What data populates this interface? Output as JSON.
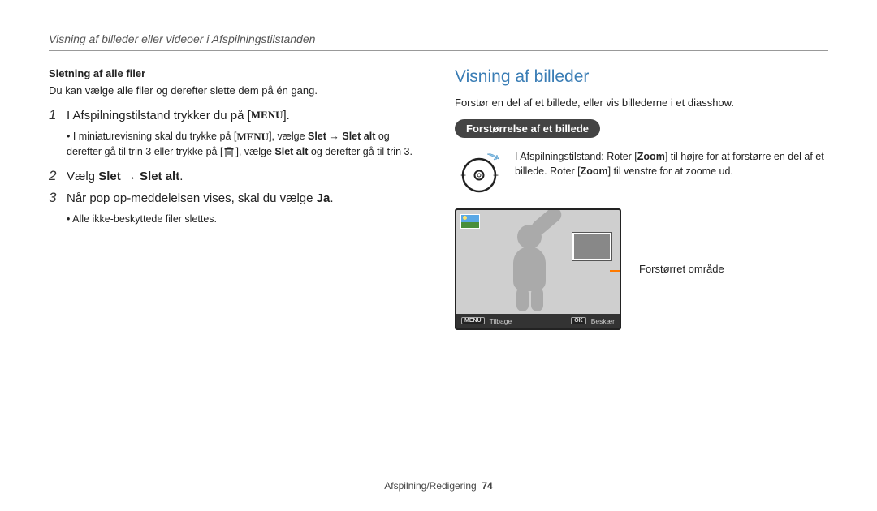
{
  "header": "Visning af billeder eller videoer i Afspilningstilstanden",
  "left": {
    "subhead": "Sletning af alle filer",
    "body": "Du kan vælge alle filer og derefter slette dem på én gang.",
    "step1_pre": "I Afspilningstilstand trykker du på [",
    "step1_post": "].",
    "menu": "MENU",
    "step1_sub_a": "I miniaturevisning skal du trykke på [",
    "step1_sub_b": "], vælge ",
    "step1_sub_bold1": "Slet → Slet alt",
    "step1_sub_c": " og derefter gå til trin 3 eller trykke på [",
    "step1_sub_d": "], vælge ",
    "step1_sub_bold2": "Slet alt",
    "step1_sub_e": " og derefter gå til trin 3.",
    "step2_pre": "Vælg ",
    "step2_bold": "Slet → Slet alt",
    "step2_post": ".",
    "step3_pre": "Når pop op-meddelelsen vises, skal du vælge ",
    "step3_bold": "Ja",
    "step3_post": ".",
    "step3_sub": "Alle ikke-beskyttede filer slettes."
  },
  "right": {
    "title": "Visning af billeder",
    "body": "Forstør en del af et billede, eller vis billederne i et diasshow.",
    "pill": "Forstørrelse af et billede",
    "zoom_a": "I Afspilningstilstand: Roter [",
    "zoom_b1": "Zoom",
    "zoom_c": "] til højre for at forstørre en del af et billede. Roter [",
    "zoom_b2": "Zoom",
    "zoom_d": "] til venstre for at zoome ud.",
    "callout": "Forstørret område",
    "bar_menu": "MENU",
    "bar_back": "Tilbage",
    "bar_ok": "OK",
    "bar_crop": "Beskær"
  },
  "footer": {
    "label": "Afspilning/Redigering",
    "page": "74"
  }
}
